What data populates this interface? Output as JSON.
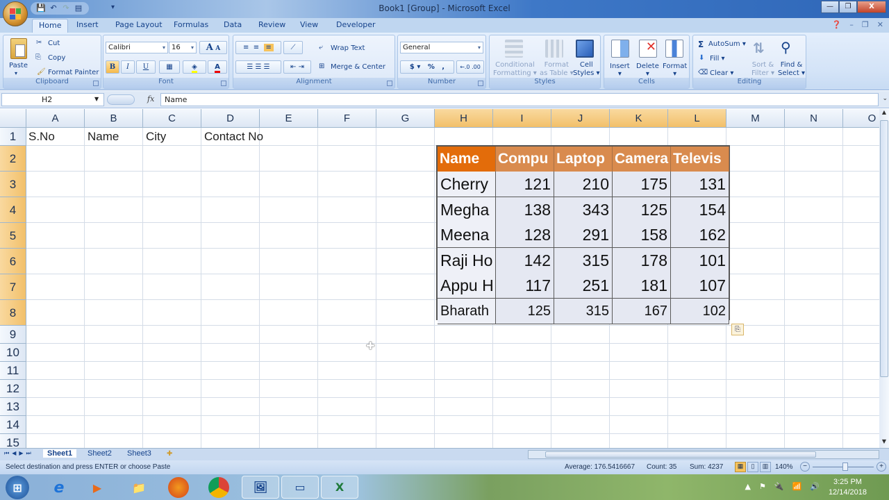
{
  "window": {
    "title": "Book1  [Group] - Microsoft Excel",
    "qat": [
      "save-icon",
      "undo-icon",
      "redo-icon",
      "form-icon",
      "customize-icon"
    ],
    "controls": {
      "minimize": "—",
      "restore": "❐",
      "close": "X"
    }
  },
  "ribbon_tabs": [
    "Home",
    "Insert",
    "Page Layout",
    "Formulas",
    "Data",
    "Review",
    "View",
    "Developer"
  ],
  "active_tab": "Home",
  "ribbon": {
    "clipboard": {
      "label": "Clipboard",
      "paste": "Paste",
      "cut": "Cut",
      "copy": "Copy",
      "format_painter": "Format Painter"
    },
    "font": {
      "label": "Font",
      "font_name": "Calibri",
      "font_size": "16",
      "bold": "B",
      "italic": "I",
      "underline": "U",
      "grow": "A",
      "shrink": "A"
    },
    "alignment": {
      "label": "Alignment",
      "wrap_text": "Wrap Text",
      "merge_center": "Merge & Center"
    },
    "number": {
      "label": "Number",
      "format": "General",
      "currency": "$",
      "percent": "%",
      "comma": ",",
      "inc_decimal": "←.0",
      "dec_decimal": ".00"
    },
    "styles": {
      "label": "Styles",
      "conditional_1": "Conditional",
      "conditional_2": "Formatting",
      "format_table_1": "Format",
      "format_table_2": "as Table",
      "cell_styles_1": "Cell",
      "cell_styles_2": "Styles"
    },
    "cells": {
      "label": "Cells",
      "insert": "Insert",
      "delete": "Delete",
      "format": "Format"
    },
    "editing": {
      "label": "Editing",
      "autosum": "AutoSum",
      "fill": "Fill",
      "clear": "Clear",
      "sort_1": "Sort &",
      "sort_2": "Filter",
      "find_1": "Find &",
      "find_2": "Select"
    }
  },
  "formula_bar": {
    "name_box": "H2",
    "fx": "fx",
    "value": "Name"
  },
  "columns": [
    "A",
    "B",
    "C",
    "D",
    "E",
    "F",
    "G",
    "H",
    "I",
    "J",
    "K",
    "L",
    "M",
    "N",
    "O"
  ],
  "selected_columns": [
    "H",
    "I",
    "J",
    "K",
    "L"
  ],
  "rows": [
    "1",
    "2",
    "3",
    "4",
    "5",
    "6",
    "7",
    "8",
    "9",
    "10",
    "11",
    "12",
    "13",
    "14",
    "15"
  ],
  "selected_rows": [
    "2",
    "3",
    "4",
    "5",
    "6",
    "7",
    "8"
  ],
  "row1": {
    "A": "S.No",
    "B": "Name",
    "C": "City",
    "D": "Contact No"
  },
  "table": {
    "headers": [
      "Name",
      "Compu",
      "Laptop",
      "Camera",
      "Televis"
    ],
    "header_colors": {
      "first": "#e36c0a",
      "rest": "#d98b4e"
    },
    "rows": [
      {
        "name": "Cherry",
        "values": [
          "121",
          "210",
          "175",
          "131"
        ]
      },
      {
        "name": "Megha",
        "values": [
          "138",
          "343",
          "125",
          "154"
        ]
      },
      {
        "name": "Meena",
        "values": [
          "128",
          "291",
          "158",
          "162"
        ]
      },
      {
        "name": "Raji Ho",
        "values": [
          "142",
          "315",
          "178",
          "101"
        ]
      },
      {
        "name": "Appu H",
        "values": [
          "117",
          "251",
          "181",
          "107"
        ]
      },
      {
        "name": "Bharath",
        "values": [
          "125",
          "315",
          "167",
          "102"
        ]
      }
    ]
  },
  "sheets": [
    "Sheet1",
    "Sheet2",
    "Sheet3"
  ],
  "active_sheet": "Sheet1",
  "status": {
    "message": "Select destination and press ENTER or choose Paste",
    "average": "Average: 176.5416667",
    "count": "Count: 35",
    "sum": "Sum: 4237",
    "zoom": "140%"
  },
  "taskbar": {
    "apps": [
      "windows-start",
      "internet-explorer",
      "media-player",
      "file-explorer",
      "firefox",
      "chrome",
      "photo-viewer",
      "projector",
      "excel"
    ],
    "time": "3:25 PM",
    "date": "12/14/2018"
  }
}
